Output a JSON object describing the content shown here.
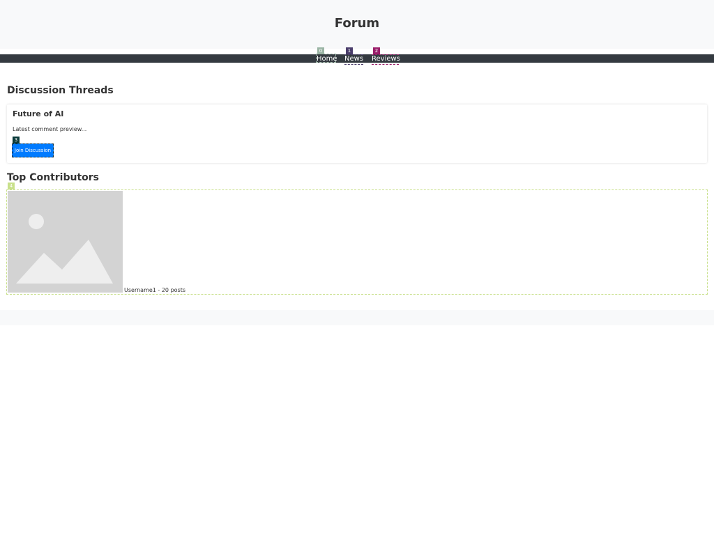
{
  "header": {
    "title": "Forum"
  },
  "nav": {
    "items": [
      {
        "label": "Home",
        "badge": "0",
        "badge_color": "#9bb5a5"
      },
      {
        "label": "News",
        "badge": "1",
        "badge_color": "#4a3d6b"
      },
      {
        "label": "Reviews",
        "badge": "2",
        "badge_color": "#9a1e6a"
      }
    ]
  },
  "threads": {
    "heading": "Discussion Threads",
    "items": [
      {
        "title": "Future of AI",
        "preview": "Latest comment preview...",
        "button_label": "Join Discussion",
        "button_badge": "3",
        "button_badge_color": "#0a3a3a",
        "button_color": "#007bff"
      }
    ]
  },
  "contributors": {
    "heading": "Top Contributors",
    "badge": "4",
    "badge_color": "#c8e08a",
    "items": [
      {
        "text": "Username1 - 20 posts",
        "avatar_icon": "image-placeholder-icon"
      }
    ]
  },
  "colors": {
    "header_bg": "#f8f9fa",
    "navbar_bg": "#343a40",
    "footer_bg": "#f8f9fa"
  }
}
